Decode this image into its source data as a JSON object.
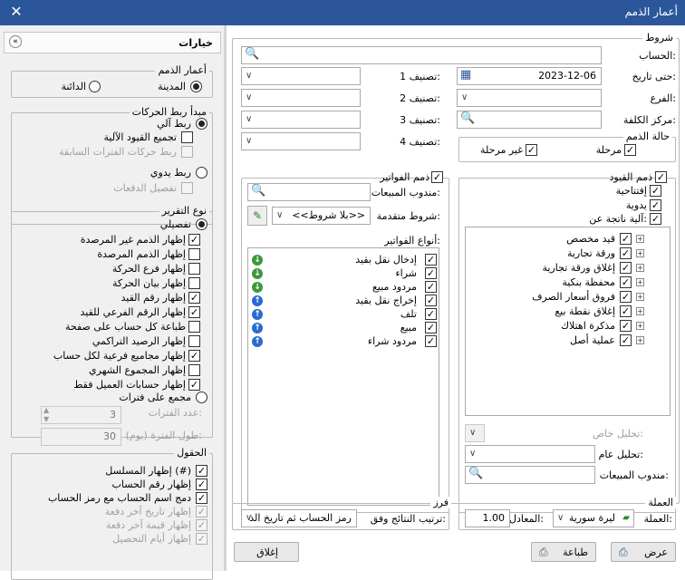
{
  "window": {
    "title": "أعمار الذمم",
    "close": "✕"
  },
  "left": {
    "header": "خيارات",
    "collapse": "«",
    "aging": {
      "title": "أعمار الذمم",
      "debtor": "المدينة",
      "creditor": "الدائنة"
    },
    "linking": {
      "title": "مبدأ ربط الحركات",
      "auto": "ربط آلي",
      "group_auto": "تجميع القيود الآلية",
      "link_prev": "ربط حركات الفترات السابقة",
      "manual": "ربط يدوي",
      "payments_detail": "تفصيل الدفعات"
    },
    "report_type": {
      "title": "نوع التقرير",
      "detailed": "تفصيلي",
      "options": [
        "إظهار الذمم غير المرصدة",
        "إظهار الذمم المرصدة",
        "إظهار فرع الحركة",
        "إظهار بيان الحركة",
        "إظهار رقم القيد",
        "إظهار الرقم الفرعي للقيد",
        "طباعة كل حساب على صفحة",
        "إظهار الرصيد التراكمي",
        "إظهار مجاميع فرعية لكل حساب",
        "إظهار المجموع الشهري",
        "إظهار حسابات العميل فقط"
      ],
      "checked": [
        true,
        false,
        false,
        false,
        true,
        true,
        false,
        false,
        true,
        false,
        true
      ],
      "periods": "مجمع على فترات",
      "period_count_label": "عدد الفترات:",
      "period_count": "3",
      "period_len_label": "طول الفترة (يوم):",
      "period_len": "30"
    },
    "fields": {
      "title": "الحقول",
      "items": [
        "إظهار المسلسل (#)",
        "إظهار رقم الحساب",
        "دمج اسم الحساب مع رمز الحساب",
        "إظهار تاريخ آخر دفعة",
        "إظهار قيمة آخر دفعة",
        "إظهار أيام التحصيل"
      ],
      "disabled": [
        false,
        false,
        false,
        true,
        true,
        true
      ]
    }
  },
  "right": {
    "conditions": {
      "title": "شروط",
      "account": "الحساب:",
      "until_date": "حتى تاريخ:",
      "date": "2023-12-06",
      "branch": "الفرع:",
      "cost_center": "مركز الكلفة:",
      "class1": "تصنيف 1:",
      "class2": "تصنيف 2:",
      "class3": "تصنيف 3:",
      "class4": "تصنيف 4:"
    },
    "status": {
      "title": "حالة الذمم",
      "posted": "مرحلة",
      "unposted": "غير مرحلة"
    },
    "entries": {
      "title": "ذمم القيود",
      "opening": "إفتتاحية",
      "manual": "يدوية",
      "auto_from": "آلية ناتجة عن:",
      "tree": [
        "قيد مخصص",
        "ورقة تجارية",
        "إغلاق ورقة تجارية",
        "محفظة بنكية",
        "فروق أسعار الصرف",
        "إغلاق نقطة بيع",
        "مذكرة اهتلاك",
        "عملية أصل"
      ],
      "special_analysis": "تحليل خاص:",
      "general_analysis": "تحليل عام:",
      "salesman": "مندوب المبيعات:"
    },
    "invoices": {
      "title": "ذمم الفواتير",
      "salesman": "مندوب المبيعات:",
      "advanced": "شروط متقدمة:",
      "advanced_value": "<<بلا شروط>>",
      "types_title": "أنواع الفواتير:",
      "types": [
        "إدخال نقل بقيد",
        "شراء",
        "مردود مبيع",
        "إخراج نقل بقيد",
        "تلف",
        "مبيع",
        "مردود شراء"
      ],
      "dirs": [
        "down",
        "down",
        "down",
        "up",
        "up",
        "up",
        "up"
      ]
    },
    "currency": {
      "title": "العملة",
      "label": "العملة:",
      "value": "ليرة سورية",
      "rate_label": "المعادل:",
      "rate": "1.00"
    },
    "sort": {
      "title": "فرز",
      "label": "ترتيب النتائج وفق:",
      "value": "رمز الحساب ثم تاريخ الذ"
    },
    "buttons": {
      "view": "عرض",
      "print": "طباعة",
      "close": "إغلاق"
    }
  }
}
